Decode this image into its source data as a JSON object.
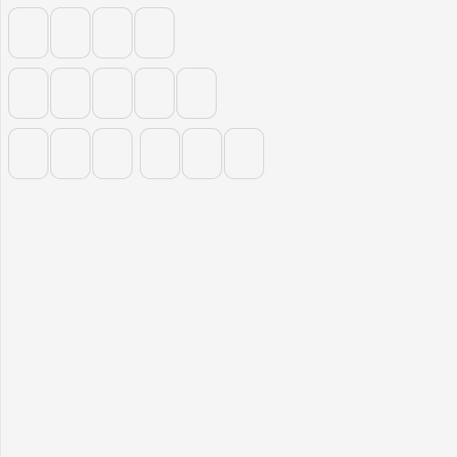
{
  "tile_grid": {
    "rows": [
      {
        "tiles": [
          "",
          "",
          "",
          ""
        ]
      },
      {
        "tiles": [
          "",
          "",
          "",
          "",
          ""
        ]
      },
      {
        "tiles": [
          "",
          "",
          "",
          "",
          "",
          ""
        ]
      }
    ]
  }
}
